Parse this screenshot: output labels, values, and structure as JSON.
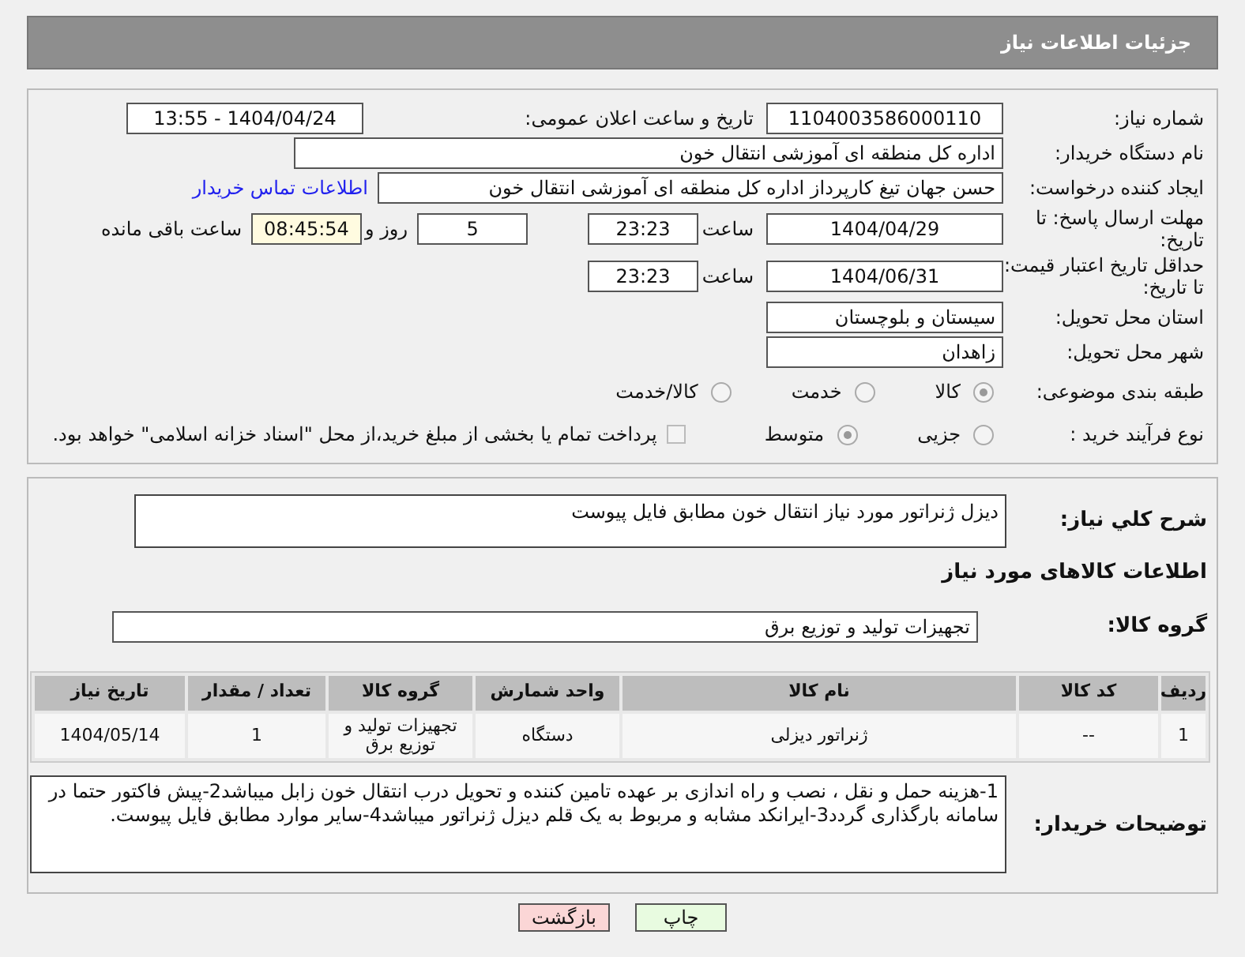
{
  "header": {
    "title": "جزئیات اطلاعات نیاز"
  },
  "need_number": {
    "label": "شماره نیاز:",
    "value": "1104003586000110"
  },
  "announce": {
    "label": "تاریخ و ساعت اعلان عمومی:",
    "value": "1404/04/24 - 13:55"
  },
  "buyer_org": {
    "label": "نام دستگاه خریدار:",
    "value": "اداره کل منطقه ای آموزشی انتقال خون"
  },
  "requester": {
    "label": "ایجاد کننده درخواست:",
    "value": "حسن جهان تیغ کارپرداز اداره کل منطقه ای آموزشی انتقال خون",
    "link": "اطلاعات تماس خریدار"
  },
  "deadline": {
    "label": "مهلت ارسال پاسخ: تا تاریخ:",
    "date": "1404/04/29",
    "time_label": "ساعت",
    "time": "23:23",
    "days": "5",
    "days_label": "روز و",
    "remaining": "08:45:54",
    "remaining_label": "ساعت باقی مانده"
  },
  "validity": {
    "label": "حداقل تاریخ اعتبار قیمت: تا تاریخ:",
    "date": "1404/06/31",
    "time_label": "ساعت",
    "time": "23:23"
  },
  "province": {
    "label": "استان محل تحویل:",
    "value": "سیستان و بلوچستان"
  },
  "city": {
    "label": "شهر محل تحویل:",
    "value": "زاهدان"
  },
  "classification": {
    "label": "طبقه بندی موضوعی:",
    "options": [
      {
        "label": "کالا",
        "selected": true
      },
      {
        "label": "خدمت",
        "selected": false
      },
      {
        "label": "کالا/خدمت",
        "selected": false
      }
    ]
  },
  "purchase_type": {
    "label": "نوع فرآیند خرید :",
    "options": [
      {
        "label": "جزیی",
        "selected": false
      },
      {
        "label": "متوسط",
        "selected": true
      }
    ],
    "treasury": {
      "label": "پرداخت تمام یا بخشی از مبلغ خرید،از محل \"اسناد خزانه اسلامی\" خواهد بود.",
      "checked": false
    }
  },
  "description": {
    "label": "شرح کلي نياز:",
    "value": "دیزل ژنراتور مورد نیاز انتقال خون مطابق فایل پیوست"
  },
  "goods_heading": "اطلاعات کالاهای مورد نیاز",
  "goods_group": {
    "label": "گروه کالا:",
    "value": "تجهیزات تولید و توزیع برق"
  },
  "table": {
    "columns": [
      "ردیف",
      "کد کالا",
      "نام کالا",
      "واحد شمارش",
      "گروه کالا",
      "تعداد / مقدار",
      "تاریخ نیاز"
    ],
    "rows": [
      [
        "1",
        "--",
        "ژنراتور دیزلی",
        "دستگاه",
        "تجهیزات تولید و توزیع برق",
        "1",
        "1404/05/14"
      ]
    ]
  },
  "buyer_notes": {
    "label": "توضیحات خریدار:",
    "value": "1-هزینه حمل و نقل ، نصب و راه اندازی بر عهده تامین کننده و تحویل درب انتقال خون زابل میباشد2-پیش فاکتور حتما در سامانه بارگذاری گردد3-ایرانکد مشابه و مربوط به یک قلم دیزل ژنراتور میباشد4-سایر موارد مطابق فایل پیوست."
  },
  "buttons": [
    {
      "kind": "print",
      "label": "چاپ"
    },
    {
      "kind": "back",
      "label": "بازگشت"
    }
  ]
}
